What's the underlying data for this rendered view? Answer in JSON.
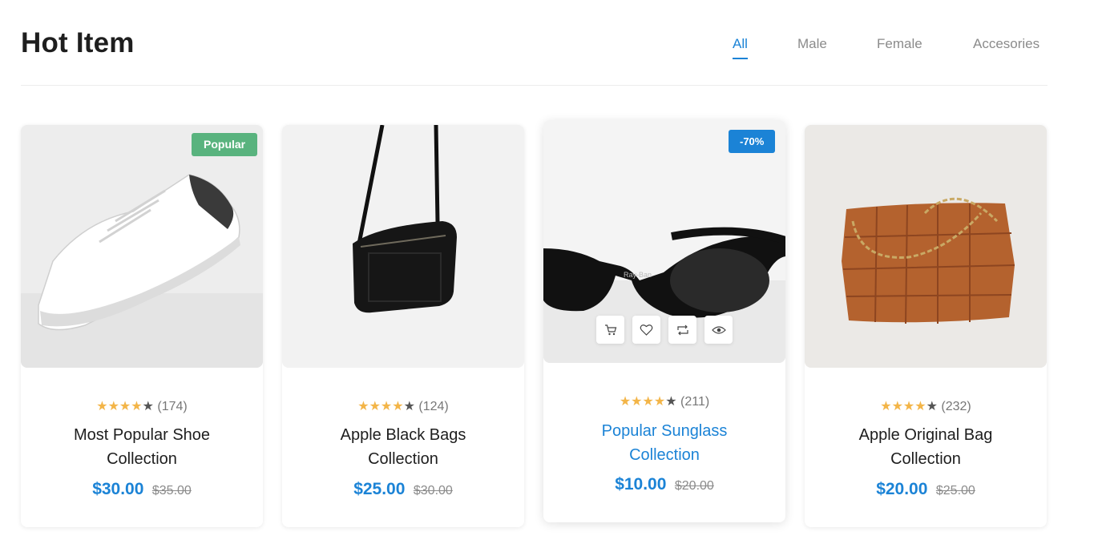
{
  "header": {
    "title": "Hot Item"
  },
  "tabs": [
    {
      "label": "All",
      "active": true
    },
    {
      "label": "Male",
      "active": false
    },
    {
      "label": "Female",
      "active": false
    },
    {
      "label": "Accesories",
      "active": false
    }
  ],
  "products": [
    {
      "name_line1": "Most Popular Shoe",
      "name_line2": "Collection",
      "reviews": "(174)",
      "price": "$30.00",
      "old_price": "$35.00",
      "badge": "Popular",
      "rating": 4.5,
      "image_icon": "sneaker-image"
    },
    {
      "name_line1": "Apple Black Bags",
      "name_line2": "Collection",
      "reviews": "(124)",
      "price": "$25.00",
      "old_price": "$30.00",
      "rating": 4.5,
      "image_icon": "black-bag-image"
    },
    {
      "name_line1": "Popular Sunglass",
      "name_line2": "Collection",
      "reviews": "(211)",
      "price": "$10.00",
      "old_price": "$20.00",
      "badge": "-70%",
      "rating": 4.5,
      "image_icon": "sunglasses-image"
    },
    {
      "name_line1": "Apple Original Bag",
      "name_line2": "Collection",
      "reviews": "(232)",
      "price": "$20.00",
      "old_price": "$25.00",
      "rating": 4.5,
      "image_icon": "woven-bag-image"
    }
  ],
  "quick_actions": [
    "cart-icon",
    "heart-icon",
    "compare-icon",
    "eye-icon"
  ],
  "colors": {
    "accent": "#1b83d6",
    "badge_popular": "#59b37e",
    "star": "#f3b548"
  }
}
